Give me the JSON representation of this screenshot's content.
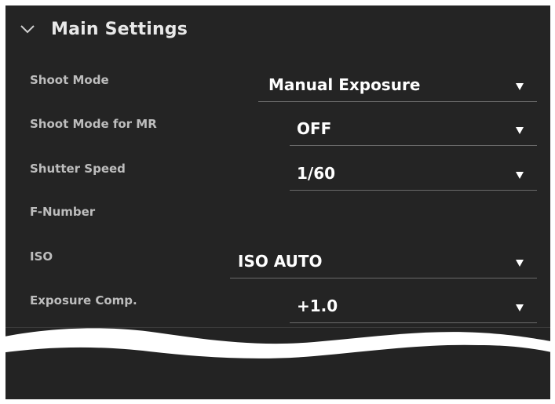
{
  "section": {
    "title": "Main Settings",
    "expand_icon": "chevron-down-icon"
  },
  "settings": [
    {
      "label": "Shoot Mode",
      "value": "Manual Exposure"
    },
    {
      "label": "Shoot Mode for MR",
      "value": "OFF"
    },
    {
      "label": "Shutter Speed",
      "value": "1/60"
    },
    {
      "label": "F-Number",
      "value": ""
    },
    {
      "label": "ISO",
      "value": "ISO AUTO"
    },
    {
      "label": "Exposure Comp.",
      "value": "+1.0"
    }
  ],
  "dropdown_icon": "triangle-down-icon",
  "colors": {
    "panel_background": "#242424",
    "label_text": "#bdbdbd",
    "value_text": "#ffffff",
    "underline": "#6a6a6a"
  }
}
